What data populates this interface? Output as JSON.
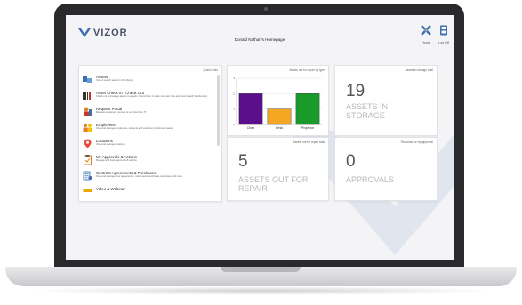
{
  "app": {
    "logo_text": "VIZOR",
    "page_title": "Donald Nathan's Homepage"
  },
  "header": {
    "home_label": "Home",
    "logout_label": "Log Off"
  },
  "quick_links": {
    "title": "Quick Links",
    "items": [
      {
        "title": "Assets",
        "desc": "View & search assets in the library",
        "icon": "assets-icon",
        "color": "#3b6fb0"
      },
      {
        "title": "Asset Check In / Check Out",
        "desc": "Check out and assign assets to people. Check them in when returned. Use quick and search functionality",
        "icon": "barcode-icon",
        "color": "#333333"
      },
      {
        "title": "Request Portal",
        "desc": "Request equipment, access or services from IT",
        "icon": "request-icon",
        "color": "#c0392b"
      },
      {
        "title": "Employees",
        "desc": "View and manage employees, students and customer profiles and assets",
        "icon": "people-icon",
        "color": "#e67e22"
      },
      {
        "title": "Locations",
        "desc": "View and manage locations",
        "icon": "location-icon",
        "color": "#e74c3c"
      },
      {
        "title": "My Approvals & Actions",
        "desc": "Manage and track approvals & actions",
        "icon": "clipboard-icon",
        "color": "#e67e22"
      },
      {
        "title": "Contract Agreements & Purchases",
        "desc": "View and manage your agreements, maintenance contracts, purchases and more",
        "icon": "contract-icon",
        "color": "#3b6fb0"
      },
      {
        "title": "Video & Webinar",
        "desc": "",
        "icon": "video-icon",
        "color": "#e6a700"
      }
    ]
  },
  "chart_card": {
    "title": "Assets out for repair by type"
  },
  "chart_data": {
    "type": "bar",
    "categories": [
      "Chair",
      "Desk",
      "Projector"
    ],
    "values": [
      2,
      1,
      2
    ],
    "colors": [
      "#5c0f8b",
      "#f5a623",
      "#1a9a2a"
    ],
    "ylim": [
      0,
      3
    ],
    "yticks": [
      "0",
      "1",
      "2",
      "3"
    ],
    "grid": true
  },
  "stats": [
    {
      "title": "Assets in storage total",
      "value": "19",
      "label_line1": "ASSETS IN",
      "label_line2": "STORAGE"
    },
    {
      "title": "Assets out for repair total",
      "value": "5",
      "label_line1": "ASSETS OUT FOR",
      "label_line2": "REPAIR"
    },
    {
      "title": "Requests for my approval",
      "value": "0",
      "label_line1": "APPROVALS",
      "label_line2": ""
    }
  ]
}
